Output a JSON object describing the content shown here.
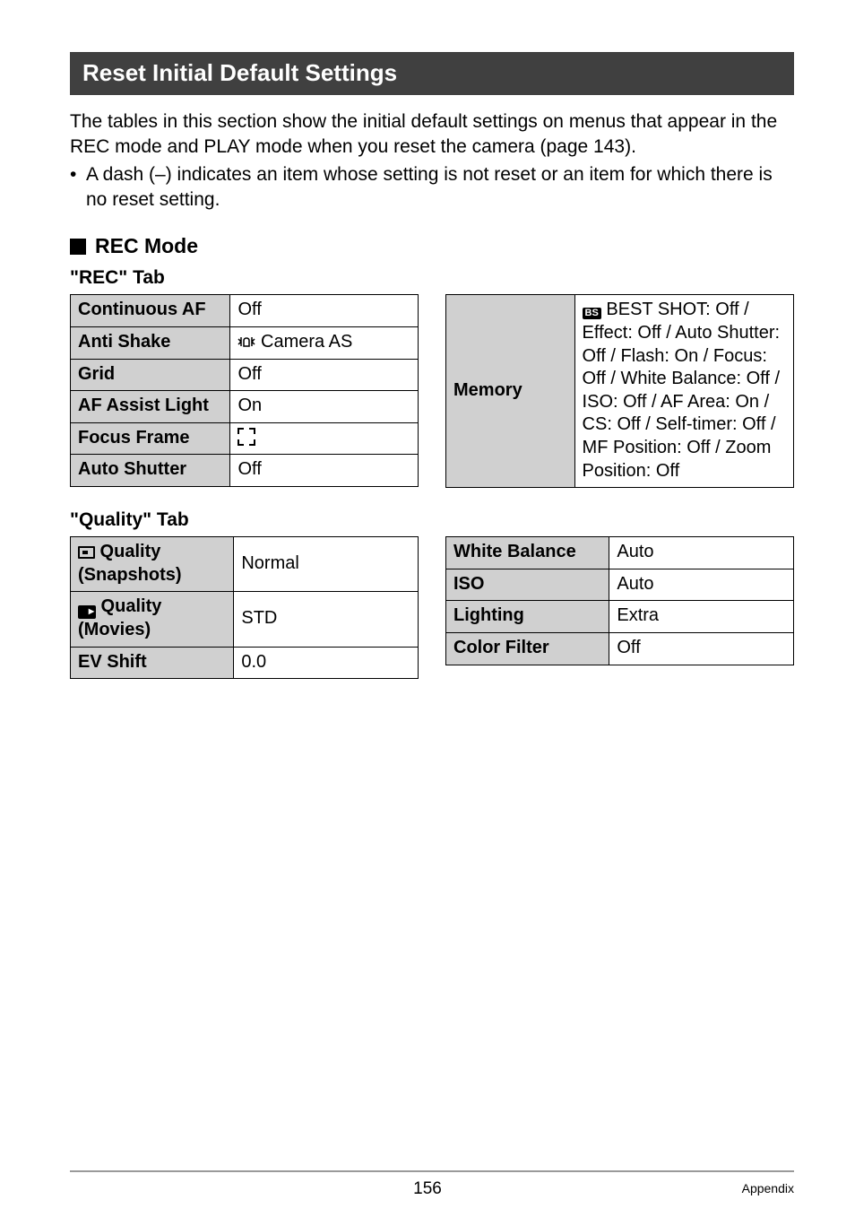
{
  "heading": "Reset Initial Default Settings",
  "intro": "The tables in this section show the initial default settings on menus that appear in the REC mode and PLAY mode when you reset the camera (page 143).",
  "bullet1": "A dash (–) indicates an item whose setting is not reset or an item for which there is no reset setting.",
  "rec_mode_heading": "REC Mode",
  "rec_tab_heading": "\"REC\" Tab",
  "rec_tab_left": [
    {
      "label": "Continuous AF",
      "value": "Off"
    },
    {
      "label": "Anti Shake",
      "value": " Camera AS",
      "icon": "antishake"
    },
    {
      "label": "Grid",
      "value": "Off"
    },
    {
      "label": "AF Assist Light",
      "value": "On"
    },
    {
      "label": "Focus Frame",
      "value": "",
      "icon": "corners"
    },
    {
      "label": "Auto Shutter",
      "value": "Off"
    }
  ],
  "memory_label": "Memory",
  "memory_value": " BEST SHOT: Off / Effect: Off / Auto Shutter: Off / Flash: On / Focus: Off / White Balance: Off / ISO: Off / AF Area: On / CS: Off / Self-timer: Off / MF Position: Off / Zoom Position: Off",
  "bs_text": "BS",
  "quality_tab_heading": "\"Quality\" Tab",
  "quality_left": [
    {
      "label": " Quality (Snapshots)",
      "value": "Normal",
      "icon": "snap"
    },
    {
      "label": " Quality (Movies)",
      "value": "STD",
      "icon": "movie"
    },
    {
      "label": "EV Shift",
      "value": "0.0"
    }
  ],
  "quality_right": [
    {
      "label": "White Balance",
      "value": "Auto"
    },
    {
      "label": "ISO",
      "value": "Auto"
    },
    {
      "label": "Lighting",
      "value": "Extra"
    },
    {
      "label": "Color Filter",
      "value": "Off"
    }
  ],
  "page_number": "156",
  "appendix": "Appendix"
}
